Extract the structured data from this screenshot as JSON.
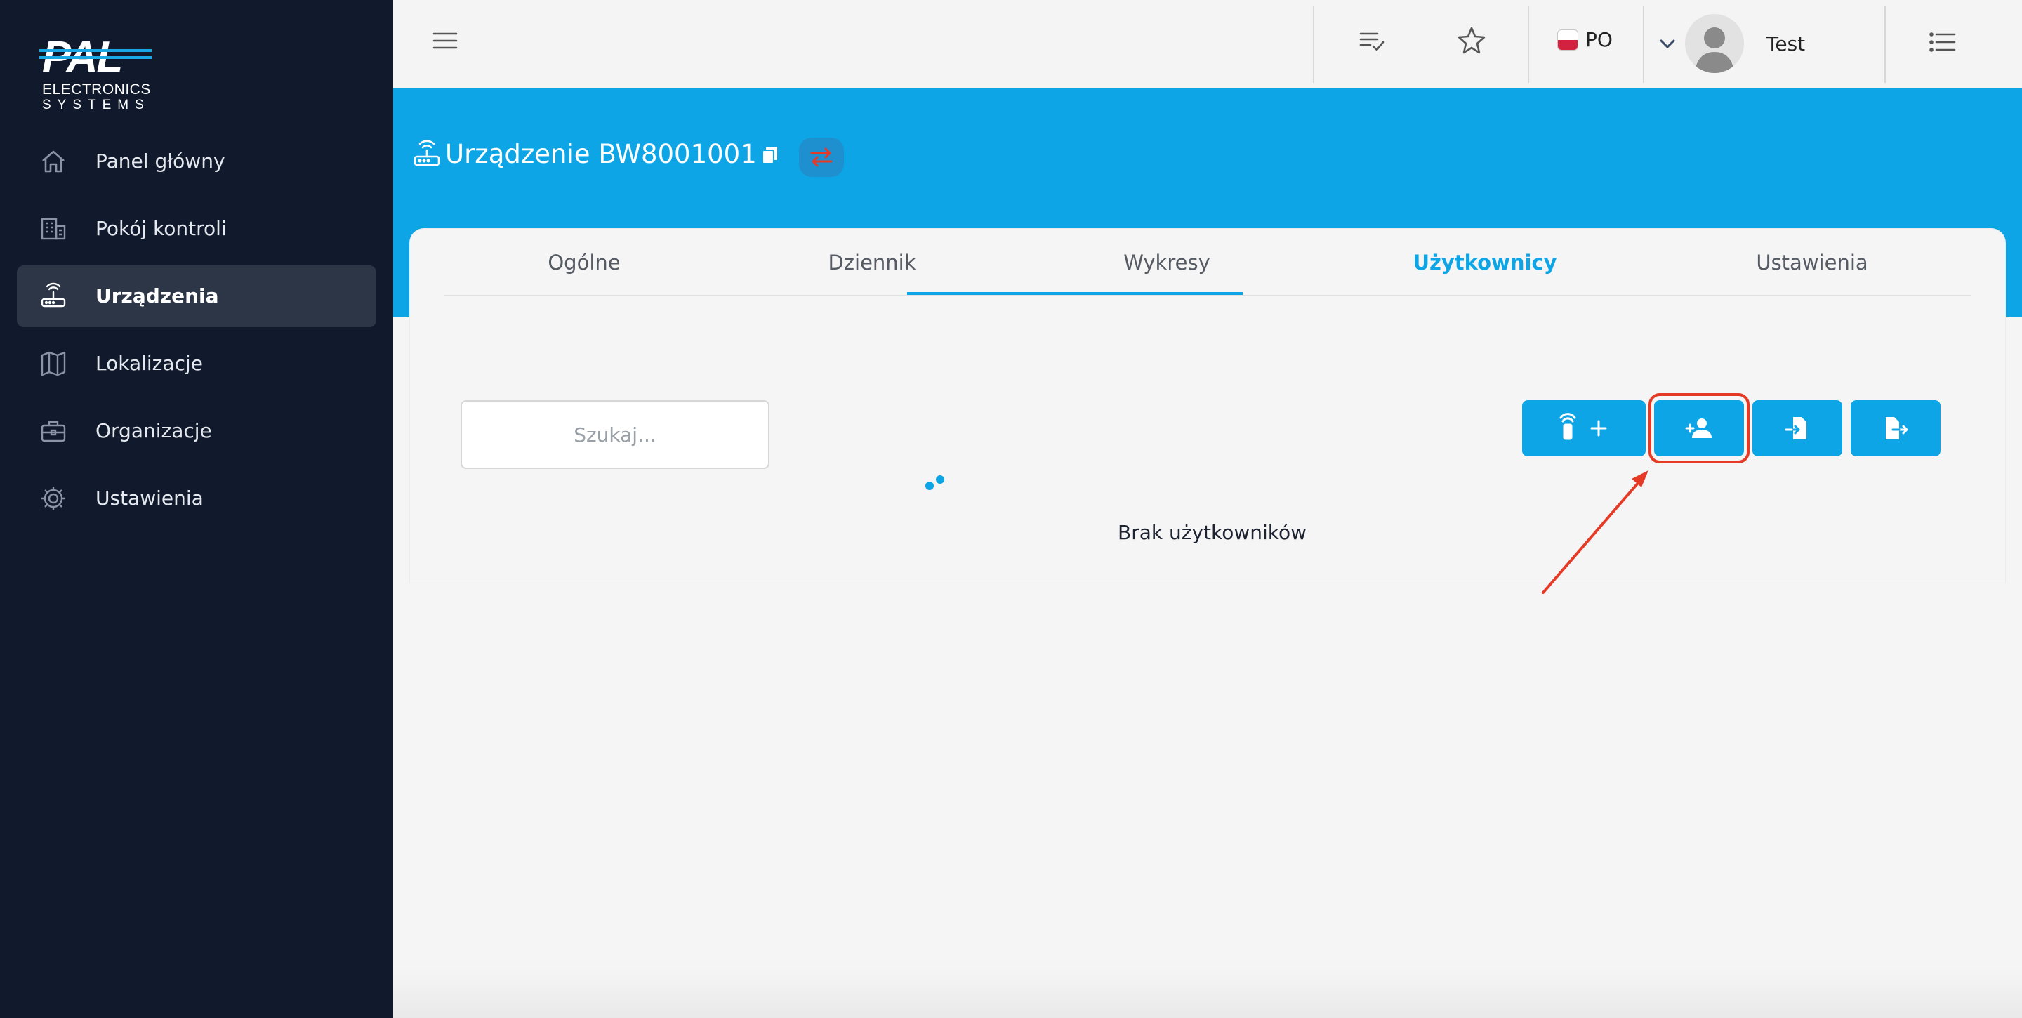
{
  "logo": {
    "brand": "PAL",
    "line1": "ELECTRONICS",
    "line2": "SYSTEMS"
  },
  "sidebar": {
    "items": [
      {
        "label": "Panel główny",
        "icon": "home-icon",
        "active": false
      },
      {
        "label": "Pokój kontroli",
        "icon": "building-icon",
        "active": false
      },
      {
        "label": "Urządzenia",
        "icon": "router-icon",
        "active": true
      },
      {
        "label": "Lokalizacje",
        "icon": "map-icon",
        "active": false
      },
      {
        "label": "Organizacje",
        "icon": "briefcase-icon",
        "active": false
      },
      {
        "label": "Ustawienia",
        "icon": "gear-icon",
        "active": false
      }
    ]
  },
  "topbar": {
    "language": "PO",
    "user_name": "Test",
    "icons": [
      "menu-icon",
      "checklist-icon",
      "star-icon",
      "flag-icon",
      "chevron-down-icon",
      "avatar",
      "list-icon"
    ]
  },
  "header": {
    "title": "Urządzenie BW8001001"
  },
  "tabs": [
    {
      "label": "Ogólne",
      "active": false
    },
    {
      "label": "Dziennik",
      "active": false
    },
    {
      "label": "Wykresy",
      "active": false
    },
    {
      "label": "Użytkownicy",
      "active": true
    },
    {
      "label": "Ustawienia",
      "active": false
    }
  ],
  "users": {
    "search_placeholder": "Szukaj...",
    "empty_message": "Brak użytkowników",
    "actions": [
      "add-remote-button",
      "add-user-button",
      "import-button",
      "export-button"
    ]
  },
  "colors": {
    "sidebar_bg": "#111a2c",
    "sidebar_active": "#2d3647",
    "accent": "#0ea5e6",
    "highlight": "#e53a26"
  }
}
